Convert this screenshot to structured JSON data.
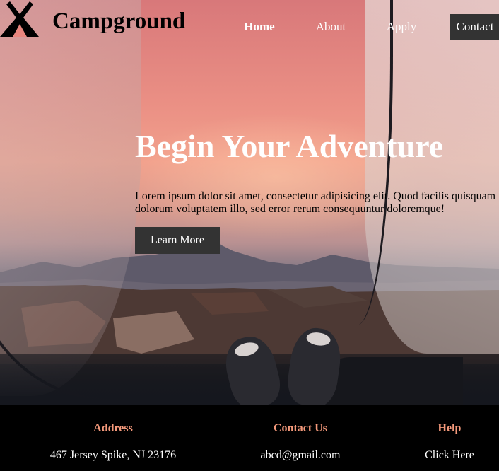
{
  "nav": {
    "brand": "Campground",
    "links": [
      "Home",
      "About",
      "Apply",
      "Contact"
    ],
    "active": "Home"
  },
  "hero": {
    "title": "Begin Your Adventure",
    "text": "Lorem ipsum dolor sit amet, consectetur adipisicing elit. Quod facilis quisquam dolorum voluptatem illo, sed error rerum consequuntur doloremque!",
    "button": "Learn More"
  },
  "footer": {
    "columns": [
      {
        "heading": "Address",
        "text": "467 Jersey Spike, NJ 23176"
      },
      {
        "heading": "Contact Us",
        "text": "abcd@gmail.com"
      },
      {
        "heading": "Help",
        "text": "Click Here"
      }
    ]
  },
  "colors": {
    "accent": "#f4997b",
    "button": "#333333"
  },
  "icons": {
    "logo": "tent-icon"
  }
}
